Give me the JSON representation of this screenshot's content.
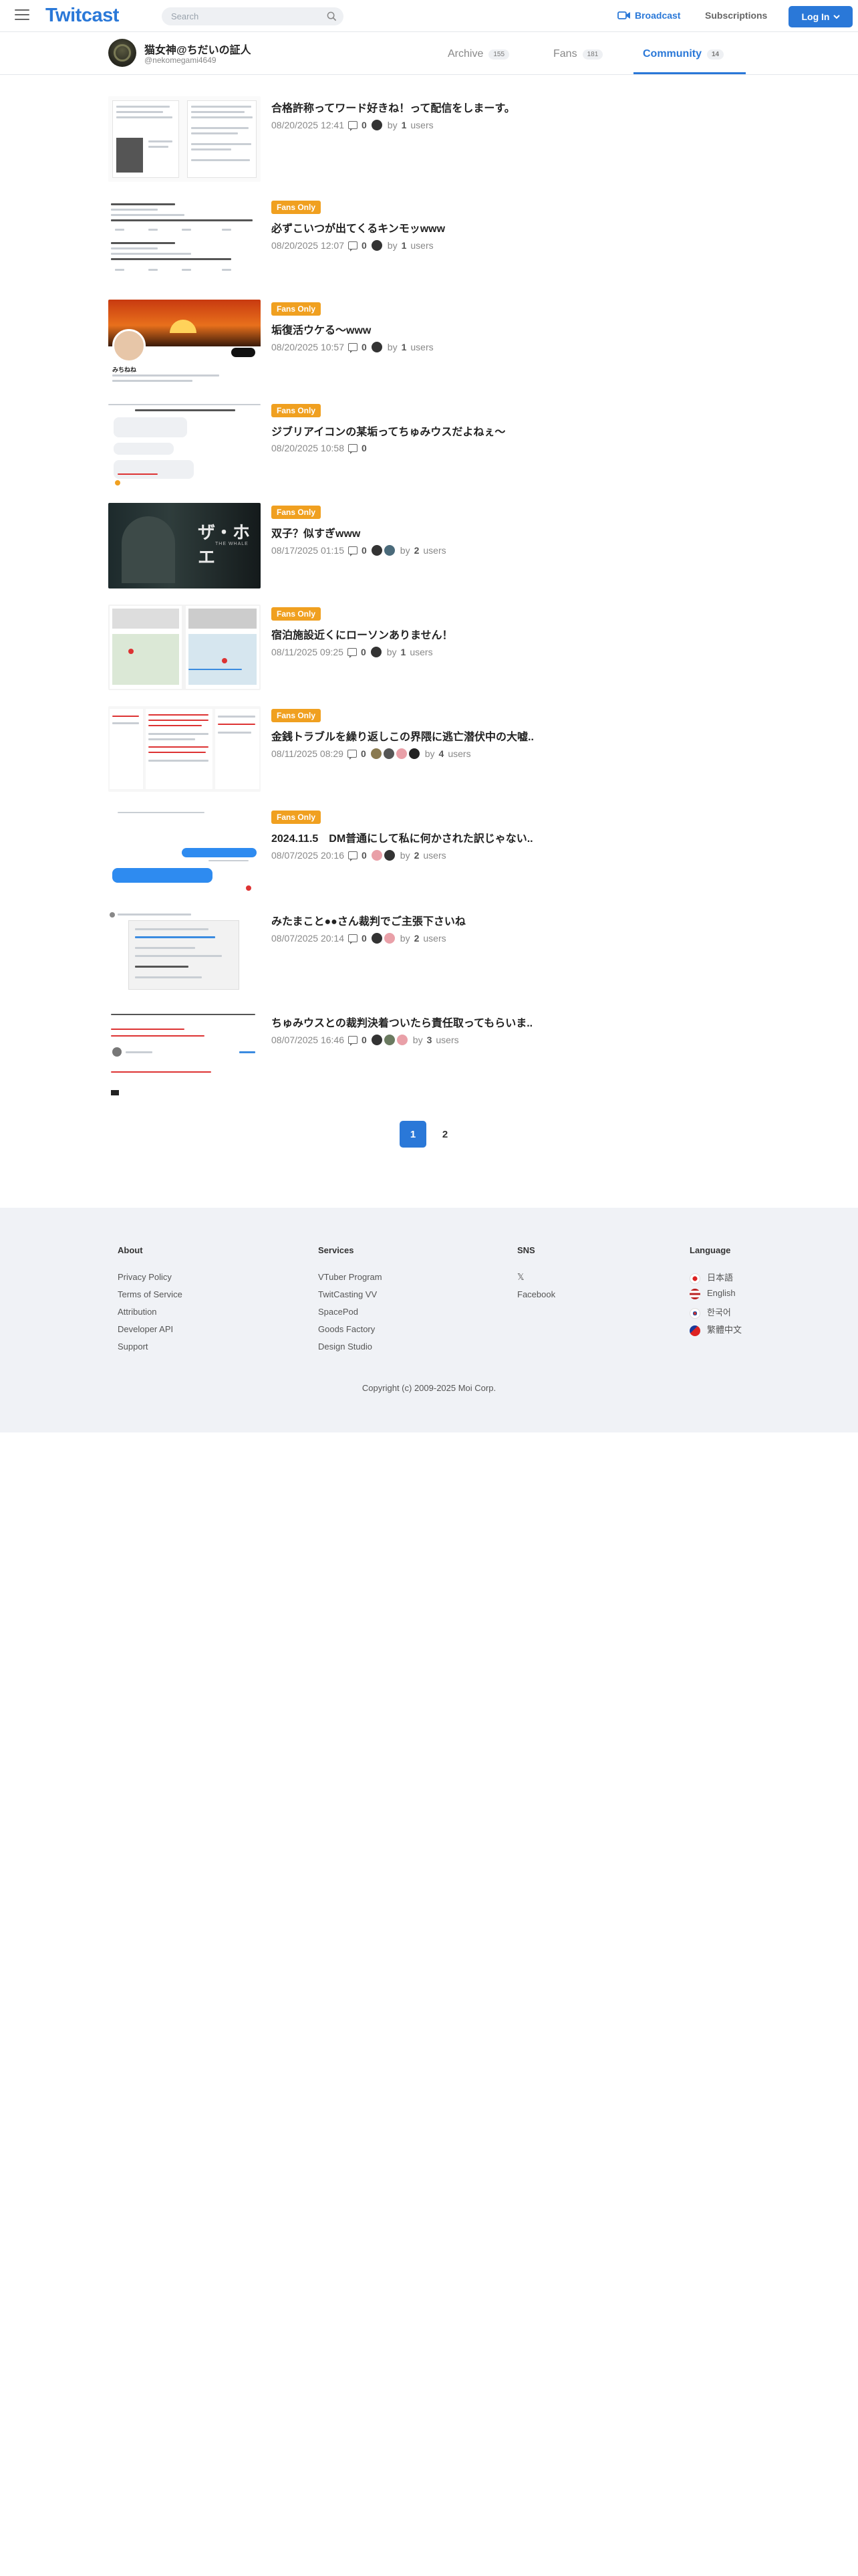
{
  "nav": {
    "logo": "Twitcast",
    "search_placeholder": "Search",
    "broadcast": "Broadcast",
    "subscriptions": "Subscriptions",
    "login": "Log In"
  },
  "profile": {
    "name": "猫女神@ちだいの証人",
    "handle": "@nekomegami4649",
    "tabs": [
      {
        "label": "Archive",
        "count": "155"
      },
      {
        "label": "Fans",
        "count": "181"
      },
      {
        "label": "Community",
        "count": "14"
      }
    ]
  },
  "posts": [
    {
      "badge": "",
      "title": "合格許称ってワード好きね！って配信をしまーす。",
      "date": "08/20/2025 12:41",
      "comments": "0",
      "by": "by",
      "users": "1",
      "users_label": "users"
    },
    {
      "badge": "Fans Only",
      "title": "必ずこいつが出てくるキンモッwww",
      "date": "08/20/2025 12:07",
      "comments": "0",
      "by": "by",
      "users": "1",
      "users_label": "users"
    },
    {
      "badge": "Fans Only",
      "title": "垢復活ウケる〜www",
      "date": "08/20/2025 10:57",
      "comments": "0",
      "by": "by",
      "users": "1",
      "users_label": "users"
    },
    {
      "badge": "Fans Only",
      "title": "ジブリアイコンの某垢ってちゅみウスだよねぇ〜",
      "date": "08/20/2025 10:58",
      "comments": "0",
      "by": "",
      "users": "",
      "users_label": ""
    },
    {
      "badge": "Fans Only",
      "title": "双子？似すぎwww",
      "date": "08/17/2025 01:15",
      "comments": "0",
      "by": "by",
      "users": "2",
      "users_label": "users"
    },
    {
      "badge": "Fans Only",
      "title": "宿泊施設近くにローソンありません！",
      "date": "08/11/2025 09:25",
      "comments": "0",
      "by": "by",
      "users": "1",
      "users_label": "users"
    },
    {
      "badge": "Fans Only",
      "title": "金銭トラブルを繰り返しこの界隈に逃亡潜伏中の大嘘..",
      "date": "08/11/2025 08:29",
      "comments": "0",
      "by": "by",
      "users": "4",
      "users_label": "users"
    },
    {
      "badge": "Fans Only",
      "title": "2024.11.5　DM普通にして私に何かされた訳じゃない..",
      "date": "08/07/2025 20:16",
      "comments": "0",
      "by": "by",
      "users": "2",
      "users_label": "users"
    },
    {
      "badge": "",
      "title": "みたまこと●●さん裁判でご主張下さいね",
      "date": "08/07/2025 20:14",
      "comments": "0",
      "by": "by",
      "users": "2",
      "users_label": "users"
    },
    {
      "badge": "",
      "title": "ちゅみウスとの裁判決着ついたら責任取ってもらいま..",
      "date": "08/07/2025 16:46",
      "comments": "0",
      "by": "by",
      "users": "3",
      "users_label": "users"
    }
  ],
  "thumb_text": {
    "t3_name": "みちねね",
    "t5_caption": "ザ・ホエ",
    "t5_sub": "THE WHALE"
  },
  "pagination": {
    "current": "1",
    "next": "2"
  },
  "footer": {
    "about": {
      "heading": "About",
      "links": [
        "Privacy Policy",
        "Terms of Service",
        "Attribution",
        "Developer API",
        "Support"
      ]
    },
    "services": {
      "heading": "Services",
      "links": [
        "VTuber Program",
        "TwitCasting VV",
        "SpacePod",
        "Goods Factory",
        "Design Studio"
      ]
    },
    "sns": {
      "heading": "SNS",
      "links": [
        "𝕏",
        "Facebook"
      ]
    },
    "language": {
      "heading": "Language",
      "links": [
        "日本語",
        "English",
        "한국어",
        "繁體中文"
      ]
    },
    "copyright": "Copyright (c) 2009-2025 Moi Corp."
  },
  "colors": {
    "accent": "#2a78d8",
    "badge": "#f0a020",
    "footer_bg": "#f0f2f6"
  },
  "icons": [
    "menu-icon",
    "search-icon",
    "broadcast-icon",
    "chevron-down-icon",
    "comment-icon",
    "user-avatar-icon",
    "flag-icon"
  ]
}
